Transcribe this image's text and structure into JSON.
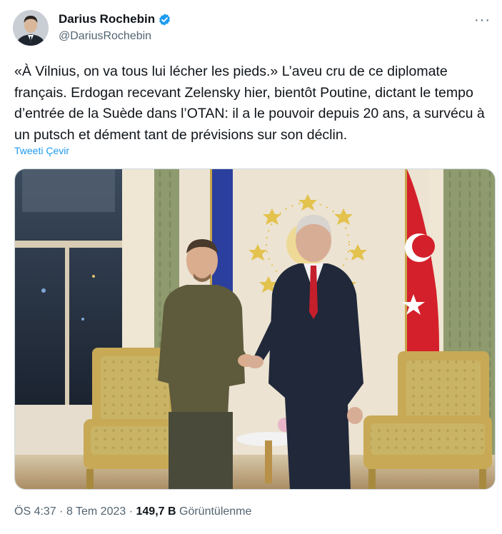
{
  "author": {
    "name": "Darius Rochebin",
    "handle": "@DariusRochebin"
  },
  "tweet": {
    "text": "«À Vilnius, on va tous lui lécher les pieds.» L’aveu cru de ce diplomate français. Erdogan recevant Zelensky hier, bientôt Poutine, dictant le tempo d’entrée de la Suède dans l’OTAN: il a le pouvoir depuis 20 ans, a survécu à un putsch et dément tant de prévisions sur son déclin.",
    "translate_label": "Tweeti Çevir"
  },
  "meta": {
    "time": "ÖS 4:37",
    "separator": "·",
    "date": "8 Tem 2023",
    "views_count": "149,7 B",
    "views_label": "Görüntülenme"
  },
  "icons": {
    "verified": "verified-badge-icon",
    "more": "more-options-icon"
  },
  "colors": {
    "accent": "#1d9bf0",
    "secondary_text": "#536471",
    "primary_text": "#0f1419"
  }
}
